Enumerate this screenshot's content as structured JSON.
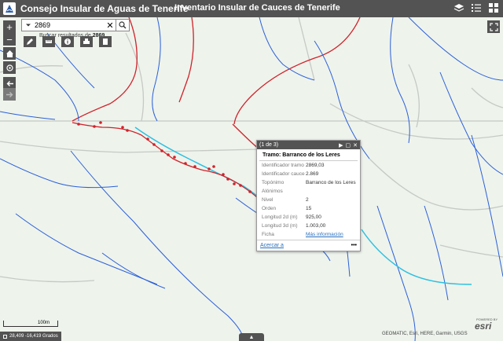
{
  "header": {
    "app_title": "Consejo Insular de Aguas de Tenerife",
    "sub_title": "Inventario Insular de Cauces de Tenerife"
  },
  "icons": {
    "logo": "cia-logo-icon",
    "layers": "layers-icon",
    "legend": "legend-list-icon",
    "basemap": "basemap-grid-icon"
  },
  "search": {
    "value": "2869",
    "placeholder": "Buscar",
    "hint_prefix": "Buscar resultados de",
    "hint_term": "2869"
  },
  "zoom": {
    "in": "+",
    "out": "−"
  },
  "popup": {
    "page": "(1 de 3)",
    "title": "Tramo: Barranco de los Leres",
    "attributes": [
      {
        "key": "Identificador tramo",
        "value": "2869,03"
      },
      {
        "key": "Identificador cauce",
        "value": "2.869"
      },
      {
        "key": "Topónimo",
        "value": "Barranco de los Leres"
      },
      {
        "key": "Alónimos",
        "value": ""
      },
      {
        "key": "Nivel",
        "value": "2"
      },
      {
        "key": "Orden",
        "value": "15"
      },
      {
        "key": "Longitud 2d (m)",
        "value": "925,00"
      },
      {
        "key": "Longitud 3d (m)",
        "value": "1.003,00"
      },
      {
        "key": "Ficha",
        "value": "Más información"
      }
    ],
    "zoom_to": "Acercar a",
    "more": "•••"
  },
  "status": {
    "scale_label": "100m",
    "coordinates": "28,409 -16,419 Grados",
    "attribution": "GEOMATIC, Esri, HERE, Garmin, USGS",
    "esri": "esri",
    "powered_by": "POWERED BY",
    "expand": "▲"
  },
  "colors": {
    "header_bg": "#535353",
    "map_bg": "#eef3ec",
    "stream": "#2a5fd8",
    "road": "#d0222a",
    "selected": "#2ec0e0"
  }
}
